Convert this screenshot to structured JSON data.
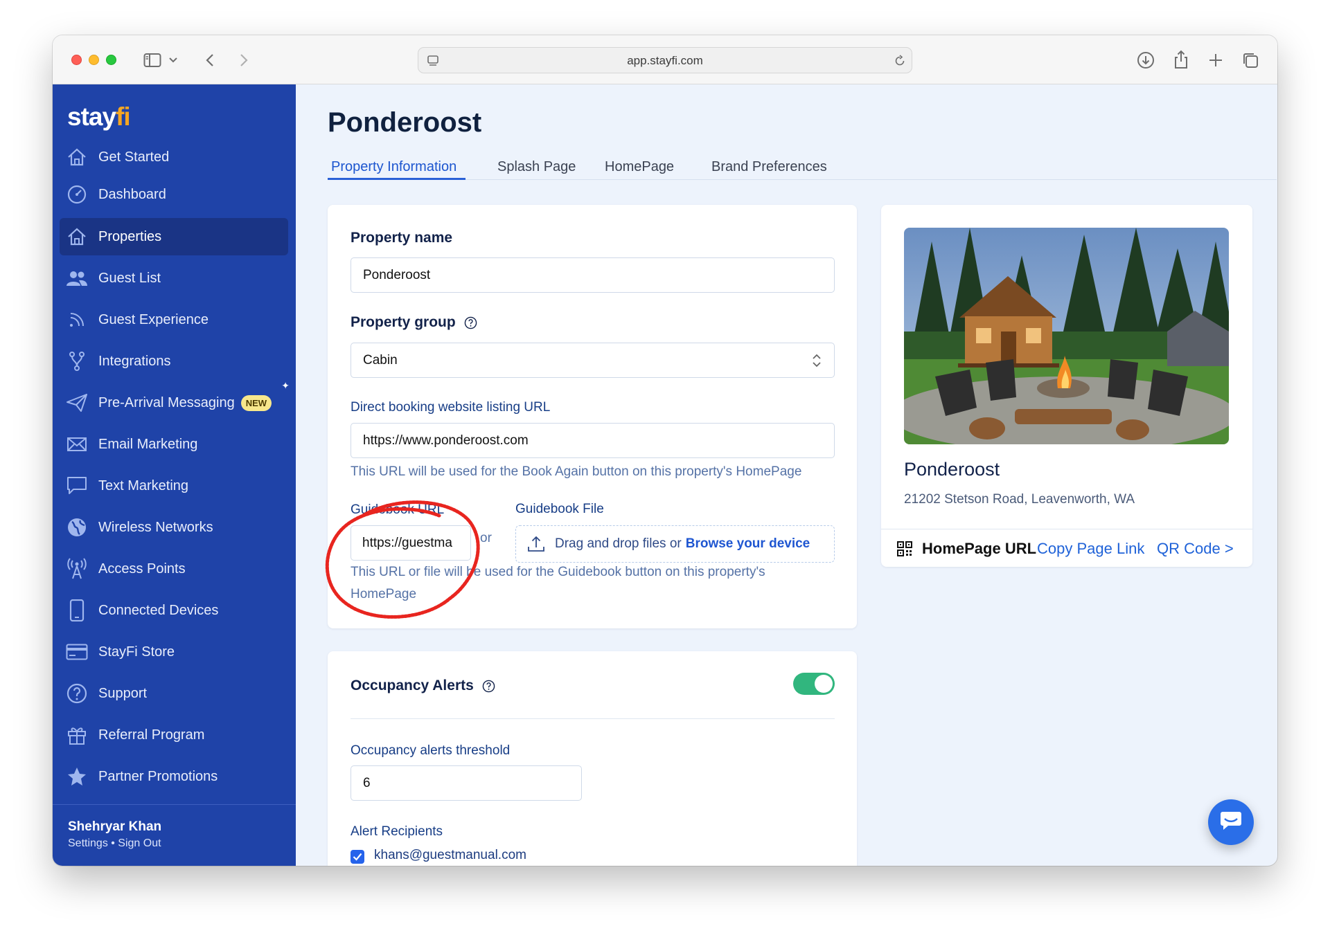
{
  "browser": {
    "url": "app.stayfi.com"
  },
  "sidebar": {
    "logo_text": "stay",
    "logo_accent": "fi",
    "items": [
      {
        "label": "Get Started",
        "icon": "home-icon"
      },
      {
        "label": "Dashboard",
        "icon": "gauge-icon"
      },
      {
        "label": "Properties",
        "icon": "home-icon",
        "active": true
      },
      {
        "label": "Guest List",
        "icon": "users-icon"
      },
      {
        "label": "Guest Experience",
        "icon": "rss-icon"
      },
      {
        "label": "Integrations",
        "icon": "fork-icon"
      },
      {
        "label": "Pre-Arrival Messaging",
        "icon": "paper-plane-icon",
        "badge": "NEW"
      },
      {
        "label": "Email Marketing",
        "icon": "envelope-icon"
      },
      {
        "label": "Text Marketing",
        "icon": "chat-bubble-icon"
      },
      {
        "label": "Wireless Networks",
        "icon": "globe-icon"
      },
      {
        "label": "Access Points",
        "icon": "antenna-icon"
      },
      {
        "label": "Connected Devices",
        "icon": "phone-icon"
      },
      {
        "label": "StayFi Store",
        "icon": "credit-card-icon"
      },
      {
        "label": "Support",
        "icon": "question-circle-icon"
      },
      {
        "label": "Referral Program",
        "icon": "gift-icon"
      },
      {
        "label": "Partner Promotions",
        "icon": "star-icon"
      }
    ],
    "user": {
      "name": "Shehryar Khan",
      "links": "Settings • Sign Out"
    }
  },
  "page": {
    "title": "Ponderoost",
    "tabs": [
      "Property Information",
      "Splash Page",
      "HomePage",
      "Brand Preferences"
    ],
    "active_tab": "Property Information"
  },
  "property_form": {
    "name_label": "Property name",
    "name_value": "Ponderoost",
    "group_label": "Property group",
    "group_value": "Cabin",
    "booking_label": "Direct booking website listing URL",
    "booking_value": "https://www.ponderoost.com",
    "booking_help": "This URL will be used for the Book Again button on this property's HomePage",
    "guidebook_url_label": "Guidebook URL",
    "guidebook_url_value": "https://guestma",
    "or_text": "or",
    "guidebook_file_label": "Guidebook File",
    "dropzone_text": "Drag and drop files or",
    "dropzone_link": "Browse your device",
    "guidebook_help": "This URL or file will be used for the Guidebook button on this property's HomePage"
  },
  "occupancy": {
    "title": "Occupancy Alerts",
    "enabled": true,
    "threshold_label": "Occupancy alerts threshold",
    "threshold_value": "6",
    "recipients_label": "Alert Recipients",
    "recipient_email": "khans@guestmanual.com",
    "recipient_checked": true
  },
  "preview": {
    "name": "Ponderoost",
    "address": "21202 Stetson Road, Leavenworth, WA",
    "homepage_label": "HomePage URL",
    "copy_link": "Copy Page Link",
    "qr_link": "QR Code >"
  },
  "colors": {
    "sidebar": "#1f43a8",
    "sidebar_active": "#1a3485",
    "accent": "#1c55cf",
    "toggle_on": "#31b67e",
    "annotation": "#e8251f"
  }
}
